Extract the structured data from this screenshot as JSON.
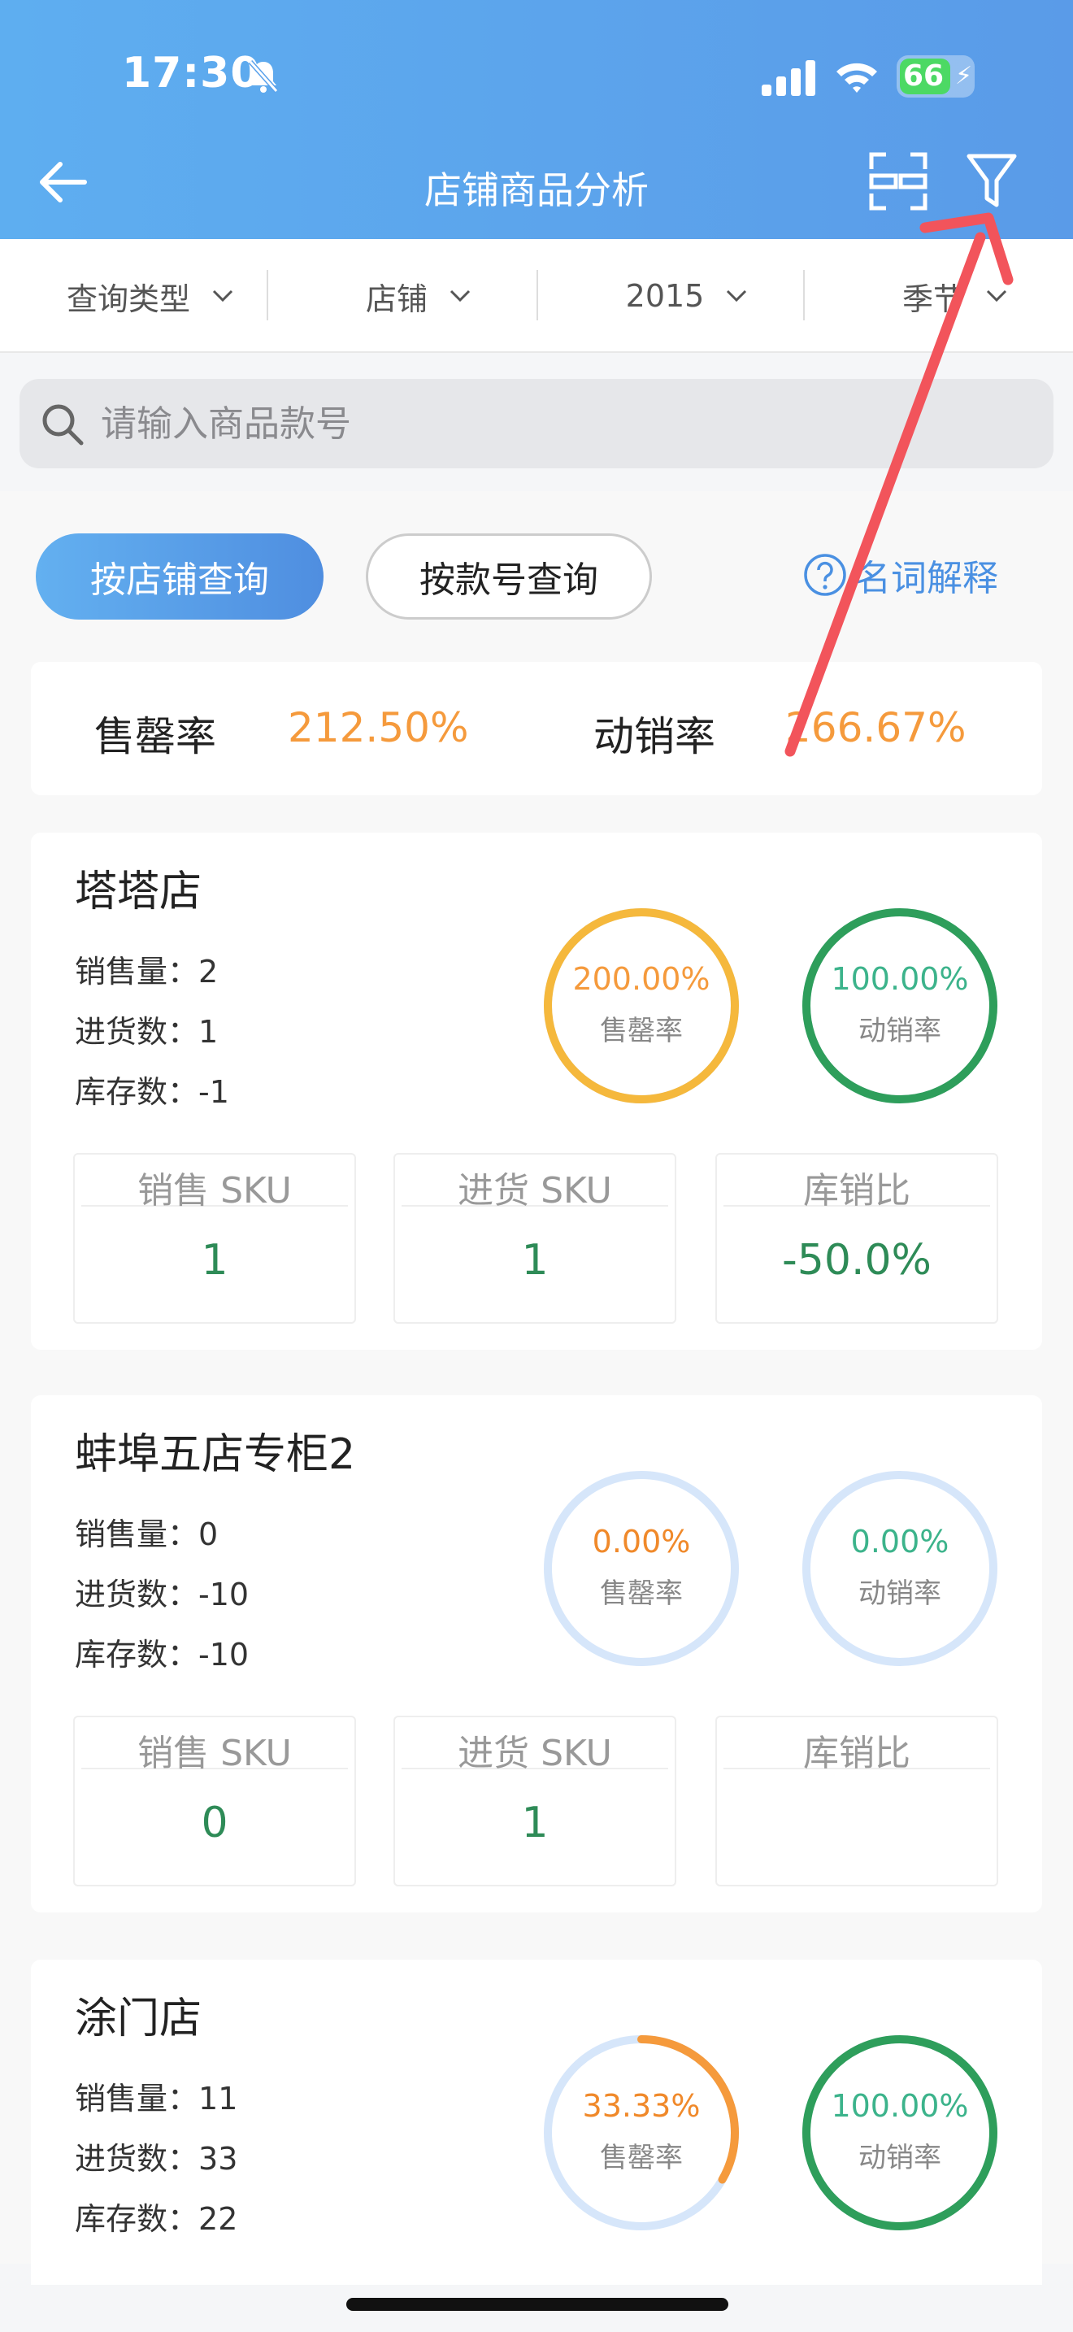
{
  "status": {
    "time": "17:30",
    "battery": "66"
  },
  "nav": {
    "title": "店铺商品分析"
  },
  "filters": [
    {
      "label": "查询类型"
    },
    {
      "label": "店铺"
    },
    {
      "label": "2015"
    },
    {
      "label": "季节"
    }
  ],
  "search": {
    "placeholder": "请输入商品款号"
  },
  "buttons": {
    "by_store": "按店铺查询",
    "by_style": "按款号查询",
    "glossary": "名词解释"
  },
  "summary": {
    "sell_through_label": "售罄率",
    "sell_through_value": "212.50%",
    "turnover_label": "动销率",
    "turnover_value": "266.67%"
  },
  "stat_labels": {
    "sales": "销售量：",
    "purchase": "进货数：",
    "stock": "库存数："
  },
  "ring_labels": {
    "sell_through": "售罄率",
    "turnover": "动销率"
  },
  "box_labels": {
    "sales_sku": "销售 SKU",
    "purchase_sku": "进货 SKU",
    "stock_sales_ratio": "库销比"
  },
  "stores": [
    {
      "name": "塔塔店",
      "sales": "2",
      "purchase": "1",
      "stock": "-1",
      "sell_through": "200.00%",
      "sell_through_fraction": 1.0,
      "turnover": "100.00%",
      "turnover_fraction": 1.0,
      "sales_sku": "1",
      "purchase_sku": "1",
      "ratio": "-50.0%"
    },
    {
      "name": "蚌埠五店专柜2",
      "sales": "0",
      "purchase": "-10",
      "stock": "-10",
      "sell_through": "0.00%",
      "sell_through_fraction": 0,
      "turnover": "0.00%",
      "turnover_fraction": 0,
      "sales_sku": "0",
      "purchase_sku": "1",
      "ratio": ""
    },
    {
      "name": "涂门店",
      "sales": "11",
      "purchase": "33",
      "stock": "22",
      "sell_through": "33.33%",
      "sell_through_fraction": 0.3333,
      "turnover": "100.00%",
      "turnover_fraction": 1.0
    }
  ],
  "colors": {
    "accent": "#4a90e2",
    "orange": "#f59a3c",
    "green": "#2e9e5b",
    "ring_empty": "#d6e6fa"
  }
}
